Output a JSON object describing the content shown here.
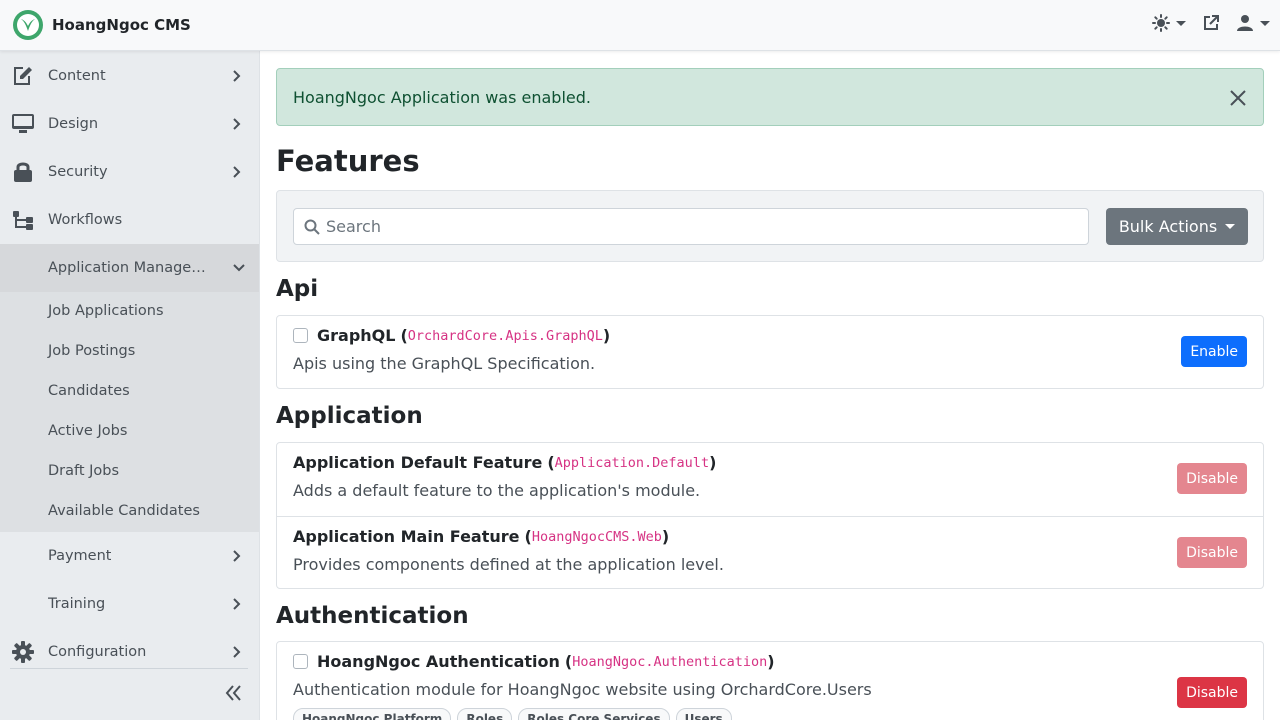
{
  "header": {
    "brand_name": "HoangNgoc CMS"
  },
  "sidebar": {
    "items": [
      {
        "label": "Content",
        "icon": "edit-icon"
      },
      {
        "label": "Design",
        "icon": "monitor-icon"
      },
      {
        "label": "Security",
        "icon": "lock-icon"
      },
      {
        "label": "Workflows",
        "icon": "workflow-icon"
      },
      {
        "label": "Application Management",
        "icon": ""
      },
      {
        "label": "Payment",
        "icon": ""
      },
      {
        "label": "Training",
        "icon": ""
      },
      {
        "label": "Configuration",
        "icon": "gear-icon"
      }
    ],
    "subitems": [
      {
        "label": "Job Applications"
      },
      {
        "label": "Job Postings"
      },
      {
        "label": "Candidates"
      },
      {
        "label": "Active Jobs"
      },
      {
        "label": "Draft Jobs"
      },
      {
        "label": "Available Candidates"
      }
    ]
  },
  "alert": {
    "message": "HoangNgoc Application was enabled."
  },
  "page": {
    "title": "Features"
  },
  "toolbar": {
    "search_placeholder": "Search",
    "bulk_actions_label": "Bulk Actions"
  },
  "sections": [
    {
      "title": "Api",
      "features": [
        {
          "name": "GraphQL",
          "id": "OrchardCore.Apis.GraphQL",
          "description": "Apis using the GraphQL Specification.",
          "action": "Enable"
        }
      ]
    },
    {
      "title": "Application",
      "features": [
        {
          "name": "Application Default Feature",
          "id": "Application.Default",
          "description": "Adds a default feature to the application's module.",
          "action": "Disable"
        },
        {
          "name": "Application Main Feature",
          "id": "HoangNgocCMS.Web",
          "description": "Provides components defined at the application level.",
          "action": "Disable"
        }
      ]
    },
    {
      "title": "Authentication",
      "features": [
        {
          "name": "HoangNgoc Authentication",
          "id": "HoangNgoc.Authentication",
          "description": "Authentication module for HoangNgoc website using OrchardCore.Users",
          "action": "Disable",
          "tags": [
            "HoangNgoc Platform",
            "Roles",
            "Roles Core Services",
            "Users"
          ]
        }
      ]
    }
  ],
  "colors": {
    "enable": "#0d6efd",
    "disable": "#dc3545",
    "feature_id": "#d63384",
    "alert_bg": "#d1e7dd"
  }
}
